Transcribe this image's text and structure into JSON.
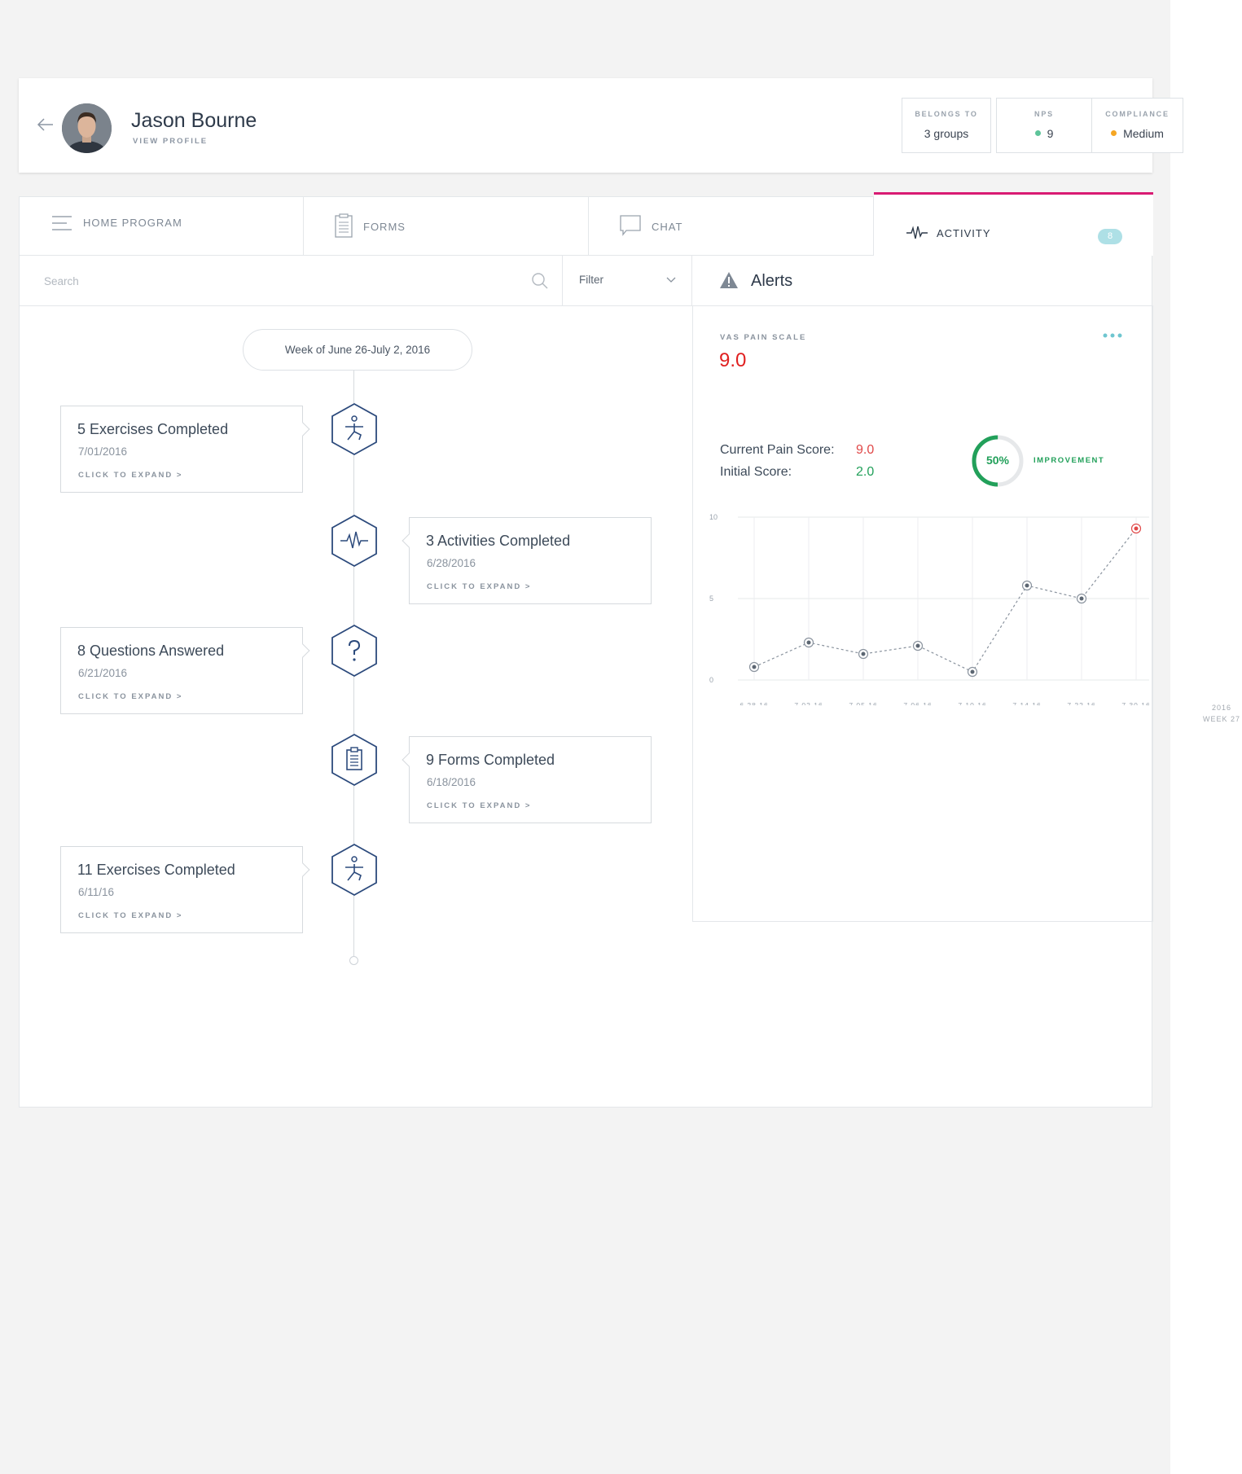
{
  "header": {
    "user_name": "Jason Bourne",
    "view_profile": "VIEW PROFILE",
    "stats": [
      {
        "label": "BELONGS TO",
        "value": "3 groups"
      },
      {
        "label": "NPS",
        "value": "9",
        "dot_color": "#5ec49a"
      },
      {
        "label": "COMPLIANCE",
        "value": "Medium",
        "dot_color": "#f5a623"
      }
    ]
  },
  "tabs": [
    {
      "label": "HOME PROGRAM",
      "icon": "menu-lines-icon"
    },
    {
      "label": "FORMS",
      "icon": "clipboard-icon"
    },
    {
      "label": "CHAT",
      "icon": "chat-bubble-icon"
    },
    {
      "label": "ACTIVITY",
      "icon": "pulse-icon",
      "badge": "8",
      "active": true
    }
  ],
  "search": {
    "placeholder": "Search"
  },
  "filter": {
    "label": "Filter"
  },
  "alerts": {
    "title": "Alerts"
  },
  "timeline": {
    "week": "Week of June 26-July 2, 2016",
    "events": [
      {
        "title": "5 Exercises Completed",
        "date": "7/01/2016",
        "expand": "CLICK TO EXPAND >",
        "icon": "exercise-figure-icon"
      },
      {
        "title": "3 Activities Completed",
        "date": "6/28/2016",
        "expand": "CLICK TO EXPAND >",
        "icon": "pulse-icon"
      },
      {
        "title": "8 Questions Answered",
        "date": "6/21/2016",
        "expand": "CLICK TO EXPAND >",
        "icon": "question-icon"
      },
      {
        "title": "9 Forms Completed",
        "date": "6/18/2016",
        "expand": "CLICK TO EXPAND >",
        "icon": "clipboard-icon"
      },
      {
        "title": "11 Exercises Completed",
        "date": "6/11/16",
        "expand": "CLICK TO EXPAND >",
        "icon": "exercise-figure-icon"
      }
    ]
  },
  "vas": {
    "label": "VAS PAIN SCALE",
    "value": "9.0",
    "current_label": "Current Pain Score:",
    "current_value": "9.0",
    "initial_label": "Initial Score:",
    "initial_value": "2.0",
    "improvement_pct": "50%",
    "improvement_fraction": 0.5,
    "improvement_label": "IMPROVEMENT"
  },
  "side_note": {
    "line1": "2016",
    "line2": "WEEK 27"
  },
  "colors": {
    "accent": "#d81b73",
    "danger": "#e02020",
    "success": "#22a05a",
    "badge": "#aee0e6",
    "icon_blue": "#2c4a7c"
  },
  "chart_data": {
    "type": "line",
    "x": [
      "6.28.16",
      "7.02.16",
      "7.05.16",
      "7.06.16",
      "7.10.16",
      "7.14.16",
      "7.22.16",
      "7.30.16"
    ],
    "values": [
      0.8,
      2.3,
      1.6,
      2.1,
      0.5,
      5.8,
      5.0,
      9.3
    ],
    "y_ticks": [
      "10",
      "5",
      "0"
    ],
    "ylim": [
      0,
      10
    ],
    "grid": true,
    "highlight_last": true
  }
}
